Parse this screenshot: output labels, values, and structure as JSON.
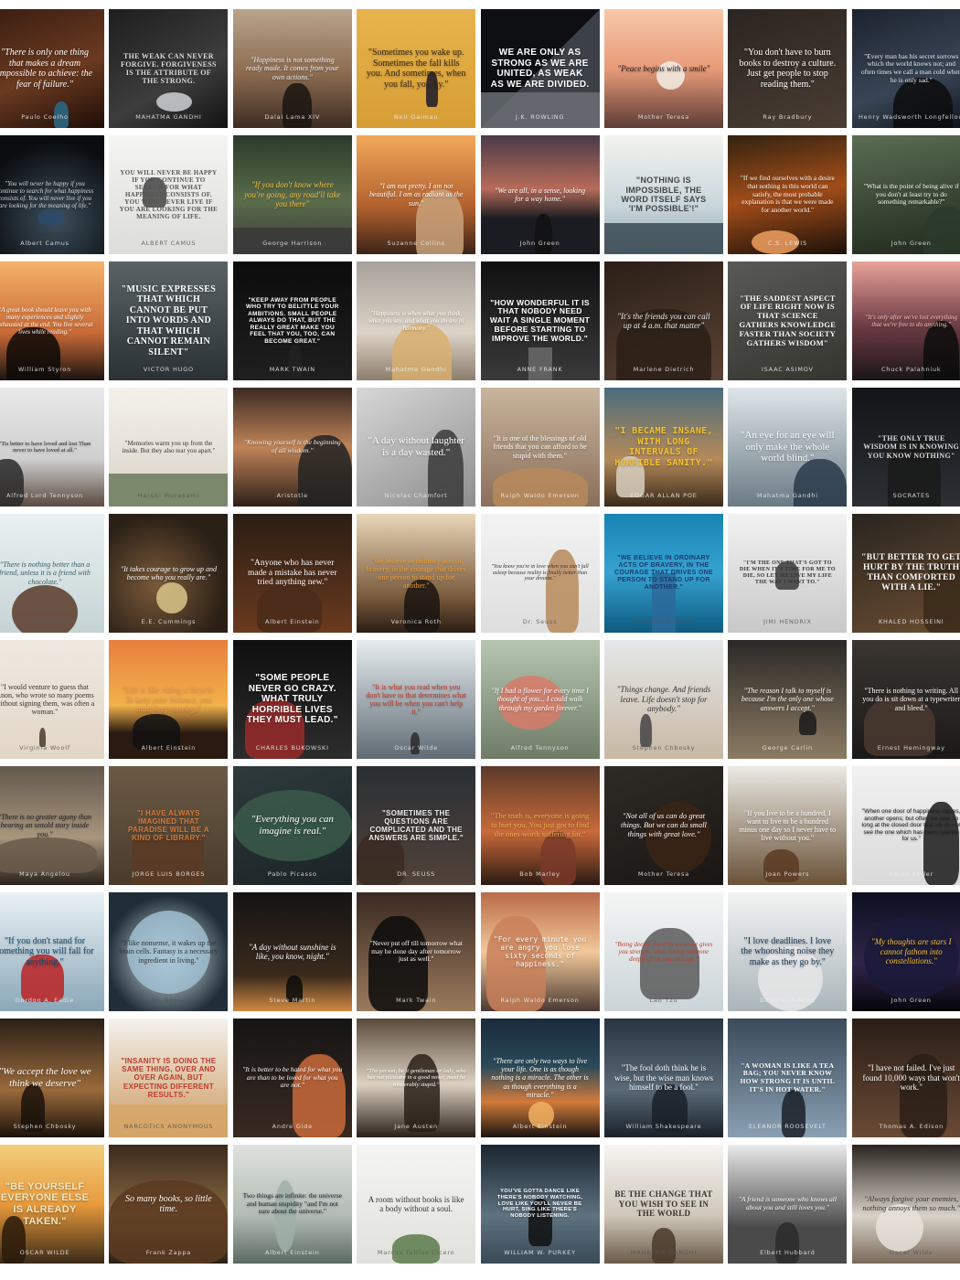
{
  "tiles": [
    {
      "quote": "\"There is only one thing that makes a dream impossible to achieve: the fear of failure.\"",
      "author": "Paulo Coelho"
    },
    {
      "quote": "THE WEAK CAN NEVER FORGIVE. FORGIVENESS IS THE ATTRIBUTE OF THE STRONG.",
      "author": "MAHATMA GANDHI"
    },
    {
      "quote": "\"Happiness is not something ready made. It comes from your own actions.\"",
      "author": "Dalai Lama XIV"
    },
    {
      "quote": "\"Sometimes you wake up. Sometimes the fall kills you. And sometimes, when you fall, you fly.\"",
      "author": "Neil Gaiman"
    },
    {
      "quote": "WE ARE ONLY AS STRONG AS WE ARE UNITED, AS WEAK AS WE ARE DIVIDED.",
      "author": "J.K. ROWLING"
    },
    {
      "quote": "\"Peace begins with a smile\"",
      "author": "Mother Teresa"
    },
    {
      "quote": "\"You don't have to burn books to destroy a culture. Just get people to stop reading them.\"",
      "author": "Ray Bradbury"
    },
    {
      "quote": "\"Every man has his secret sorrows which the world knows not; and often times we call a man cold when he is only sad.\"",
      "author": "Henry Wadsworth Longfellow"
    },
    {
      "quote": "\"You will never be happy if you continue to search for what happiness consists of. You will never live if you are looking for the meaning of life.\"",
      "author": "Albert Camus"
    },
    {
      "quote": "YOU WILL NEVER BE HAPPY IF YOU CONTINUE TO SEARCH FOR WHAT HAPPINESS CONSISTS OF. YOU WILL NEVER LIVE IF YOU ARE LOOKING FOR THE MEANING OF LIFE.",
      "author": "ALBERT CAMUS"
    },
    {
      "quote": "\"If you don't know where you're going, any road'll take you there\"",
      "author": "George Harrison"
    },
    {
      "quote": "\"I am not pretty. I am not beautiful. I am as radiant as the sun.\"",
      "author": "Suzanne Collins"
    },
    {
      "quote": "\"We are all, in a sense, looking for a way home.\"",
      "author": "John Green"
    },
    {
      "quote": "\"NOTHING IS IMPOSSIBLE, THE WORD ITSELF SAYS 'I'M POSSIBLE'!\"",
      "author": "AUDREY HEPBURN"
    },
    {
      "quote": "\"If we find ourselves with a desire that nothing in this world can satisfy, the most probable explanation is that we were made for another world.\"",
      "author": "C.S. LEWIS"
    },
    {
      "quote": "\"What is the point of being alive if you don't at least try to do something remarkable?\"",
      "author": "John Green"
    },
    {
      "quote": "\"A great book should leave you with many experiences and slightly exhausted at the end. You live several lives while reading.\"",
      "author": "William Styron"
    },
    {
      "quote": "\"MUSIC EXPRESSES THAT WHICH CANNOT BE PUT INTO WORDS AND THAT WHICH CANNOT REMAIN SILENT\"",
      "author": "VICTOR HUGO"
    },
    {
      "quote": "\"KEEP AWAY FROM PEOPLE WHO TRY TO BELITTLE YOUR AMBITIONS. SMALL PEOPLE ALWAYS DO THAT, BUT THE REALLY GREAT MAKE YOU FEEL THAT YOU, TOO, CAN BECOME GREAT.\"",
      "author": "MARK TWAIN"
    },
    {
      "quote": "\"Happiness is when what you think, what you say, and what you do are in harmony.\"",
      "author": "Mahatma Gandhi"
    },
    {
      "quote": "\"HOW WONDERFUL IT IS THAT NOBODY NEED WAIT A SINGLE MOMENT BEFORE STARTING TO IMPROVE THE WORLD.\"",
      "author": "ANNE FRANK"
    },
    {
      "quote": "\"It's the friends you can call up at 4 a.m. that matter\"",
      "author": "Marlene Dietrich"
    },
    {
      "quote": "\"THE SADDEST ASPECT OF LIFE RIGHT NOW IS THAT SCIENCE GATHERS KNOWLEDGE FASTER THAN SOCIETY GATHERS WISDOM\"",
      "author": "ISAAC ASIMOV"
    },
    {
      "quote": "\"It's only after we've lost everything that we're free to do anything.\"",
      "author": "Chuck Palahniuk"
    },
    {
      "quote": "\"Tis better to have loved and lost Than never to have loved at all.\"",
      "author": "Alfred Lord Tennyson"
    },
    {
      "quote": "\"Memories warm you up from the inside. But they also tear you apart.\"",
      "author": "Haruki Murakami"
    },
    {
      "quote": "\"Knowing yourself is the beginning of all wisdom.\"",
      "author": "Aristotle"
    },
    {
      "quote": "\"A day without laughter is a day wasted.\"",
      "author": "Nicolas Chamfort"
    },
    {
      "quote": "\"It is one of the blessings of old friends that you can afford to be stupid with them.\"",
      "author": "Ralph Waldo Emerson"
    },
    {
      "quote": "\"I BECAME INSANE, WITH LONG INTERVALS OF HORRIBLE SANITY.\"",
      "author": "EDGAR ALLAN POE"
    },
    {
      "quote": "\"An eye for an eye will only make the whole world blind.\"",
      "author": "Mahatma Gandhi"
    },
    {
      "quote": "\"THE ONLY TRUE WISDOM IS IN KNOWING YOU KNOW NOTHING\"",
      "author": "SOCRATES"
    },
    {
      "quote": "\"There is nothing better than a friend, unless it is a friend with chocolate.\"",
      "author": "Linda Grayson"
    },
    {
      "quote": "\"It takes courage to grow up and become who you really are.\"",
      "author": "E.E. Cummings"
    },
    {
      "quote": "\"Anyone who has never made a mistake has never tried anything new.\"",
      "author": "Albert Einstein"
    },
    {
      "quote": "\"We believe in ordinary acts of bravery, in the courage that drives one person to stand up for another.\"",
      "author": "Veronica Roth"
    },
    {
      "quote": "\"You know you're in love when you can't fall asleep because reality is finally better than your dreams.\"",
      "author": "Dr. Seuss"
    },
    {
      "quote": "\"WE BELIEVE IN ORDINARY ACTS OF BRAVERY, IN THE COURAGE THAT DRIVES ONE PERSON TO STAND UP FOR ANOTHER.\"",
      "author": "VERONICA ROTH"
    },
    {
      "quote": "\"I'M THE ONE THAT'S GOT TO DIE WHEN IT'S TIME FOR ME TO DIE, SO LET ME LIVE MY LIFE THE WAY I WANT TO.\"",
      "author": "JIMI HENDRIX"
    },
    {
      "quote": "\"BUT BETTER TO GET HURT BY THE TRUTH THAN COMFORTED WITH A LIE.\"",
      "author": "KHALED HOSSEINI"
    },
    {
      "quote": "\"I would venture to guess that Anon, who wrote so many poems without signing them, was often a woman.\"",
      "author": "Virginia Woolf"
    },
    {
      "quote": "\"Life is like riding a bicycle. To keep your balance, you must keep moving.\"",
      "author": "Albert Einstein"
    },
    {
      "quote": "\"SOME PEOPLE NEVER GO CRAZY. WHAT TRULY HORRIBLE LIVES THEY MUST LEAD.\"",
      "author": "CHARLES BUKOWSKI"
    },
    {
      "quote": "\"It is what you read when you don't have to that determines what you will be when you can't help it.\"",
      "author": "Oscar Wilde"
    },
    {
      "quote": "\"If I had a flower for every time I thought of you... I could walk through my garden forever.\"",
      "author": "Alfred Tennyson"
    },
    {
      "quote": "\"Things change. And friends leave. Life doesn't stop for anybody.\"",
      "author": "Stephen Chbosky"
    },
    {
      "quote": "\"The reason I talk to myself is because I'm the only one whose answers I accept.\"",
      "author": "George Carlin"
    },
    {
      "quote": "\"There is nothing to writing. All you do is sit down at a typewriter and bleed.\"",
      "author": "Ernest Hemingway"
    },
    {
      "quote": "\"There is no greater agony than bearing an untold story inside you.\"",
      "author": "Maya Angelou"
    },
    {
      "quote": "\"I HAVE ALWAYS IMAGINED THAT PARADISE WILL BE A KIND OF LIBRARY.\"",
      "author": "JORGE LUIS BORGES"
    },
    {
      "quote": "\"Everything you can imagine is real.\"",
      "author": "Pablo Picasso"
    },
    {
      "quote": "\"SOMETIMES THE QUESTIONS ARE COMPLICATED AND THE ANSWERS ARE SIMPLE.\"",
      "author": "DR. SEUSS"
    },
    {
      "quote": "\"The truth is, everyone is going to hurt you. You just got to find the ones worth suffering for.\"",
      "author": "Bob Marley"
    },
    {
      "quote": "\"Not all of us can do great things. But we can do small things with great love.\"",
      "author": "Mother Teresa"
    },
    {
      "quote": "\"If you live to be a hundred, I want to live to be a hundred minus one day so I never have to live without you.\"",
      "author": "Joan Powers"
    },
    {
      "quote": "\"When one door of happiness closes, another opens; but often we look so long at the closed door that we do not see the one which has been opened for us.\"",
      "author": "Helen Keller"
    },
    {
      "quote": "\"If you don't stand for something you will fall for anything.\"",
      "author": "Gordon A. Eadie"
    },
    {
      "quote": "\"I like nonsense, it wakes up the brain cells. Fantasy is a necessary ingredient in living.\"",
      "author": "Dr. Seuss"
    },
    {
      "quote": "\"A day without sunshine is like, you know, night.\"",
      "author": "Steve Martin"
    },
    {
      "quote": "\"Never put off till tomorrow what may be done day after tomorrow just as well.\"",
      "author": "Mark Twain"
    },
    {
      "quote": "\"For every minute you are angry you lose sixty seconds of happiness.\"",
      "author": "Ralph Waldo Emerson"
    },
    {
      "quote": "\"Being deeply loved by someone gives you strength, while loving someone deeply gives you courage.\"",
      "author": "Lao Tzu"
    },
    {
      "quote": "\"I love deadlines. I love the whooshing noise they make as they go by.\"",
      "author": "Douglas Adams"
    },
    {
      "quote": "\"My thoughts are stars I cannot fathom into constellations.\"",
      "author": "John Green"
    },
    {
      "quote": "\"We accept the love we think we deserve\"",
      "author": "Stephen Chbosky"
    },
    {
      "quote": "\"INSANITY IS DOING THE SAME THING, OVER AND OVER AGAIN, BUT EXPECTING DIFFERENT RESULTS.\"",
      "author": "NARCOTICS ANONYMOUS"
    },
    {
      "quote": "\"It is better to be hated for what you are than to be loved for what you are not.\"",
      "author": "Andre Gide"
    },
    {
      "quote": "\"The person, be it gentleman or lady, who has not pleasure in a good novel, must be intolerably stupid.\"",
      "author": "Jane Austen"
    },
    {
      "quote": "\"There are only two ways to live your life. One is as though nothing is a miracle. The other is as though everything is a miracle.\"",
      "author": "Albert Einstein"
    },
    {
      "quote": "\"The fool doth think he is wise, but the wise man knows himself to be a fool.\"",
      "author": "William Shakespeare"
    },
    {
      "quote": "\"A WOMAN IS LIKE A TEA BAG; YOU NEVER KNOW HOW STRONG IT IS UNTIL IT'S IN HOT WATER.\"",
      "author": "ELEANOR ROOSEVELT"
    },
    {
      "quote": "\"I have not failed. I've just found 10,000 ways that won't work.\"",
      "author": "Thomas A. Edison"
    },
    {
      "quote": "\"BE YOURSELF EVERYONE ELSE IS ALREADY TAKEN.\"",
      "author": "OSCAR WILDE"
    },
    {
      "quote": "So many books, so little time.",
      "author": "Frank Zappa"
    },
    {
      "quote": "Two things are infinite: the universe and human stupidity \"and I'm not sure about the universe.\"",
      "author": "Albert Einstein"
    },
    {
      "quote": "A room without books is like a body without a soul.",
      "author": "Marcus Tullius Cicero"
    },
    {
      "quote": "YOU'VE GOTTA DANCE LIKE THERE'S NOBODY WATCHING, LOVE LIKE YOU'LL NEVER BE HURT, SING LIKE THERE'S NOBODY LISTENING.",
      "author": "WILLIAM W. PURKEY"
    },
    {
      "quote": "BE THE CHANGE THAT YOU WISH TO SEE IN THE WORLD",
      "author": "MAHATMA GANDHI"
    },
    {
      "quote": "\"A friend is someone who knows all about you and still loves you.\"",
      "author": "Elbert Hubbard"
    },
    {
      "quote": "\"Always forgive your enemies, nothing annoys them so much.\"",
      "author": "Oscar Wilde"
    }
  ]
}
